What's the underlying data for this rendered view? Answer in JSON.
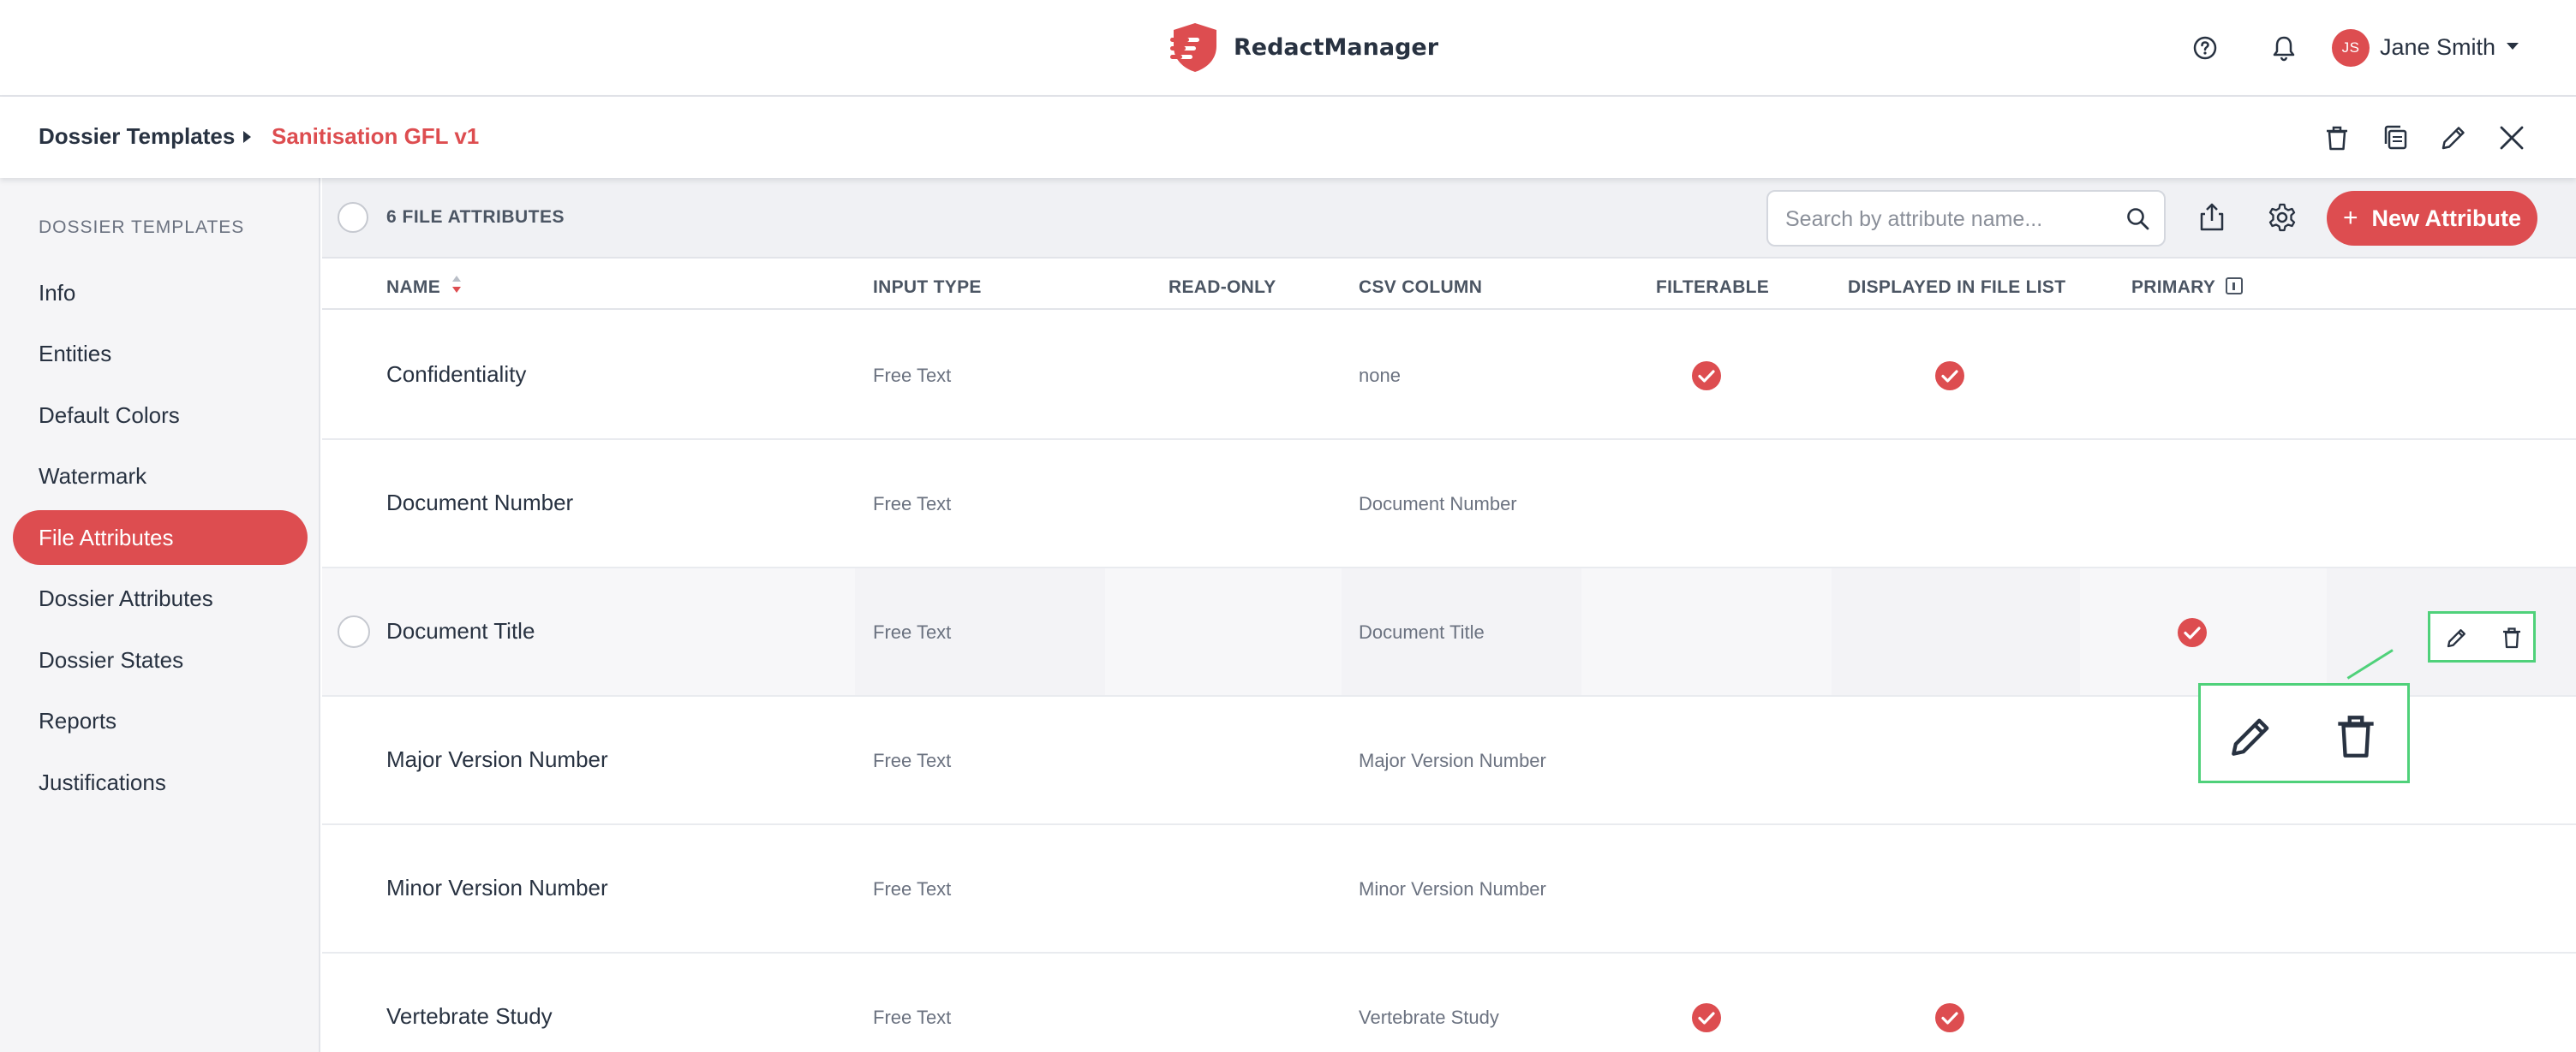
{
  "app": {
    "name": "RedactManager",
    "brand_color": "#dd4d50",
    "user": {
      "initials": "JS",
      "name": "Jane Smith"
    }
  },
  "breadcrumb": {
    "root": "Dossier Templates",
    "current": "Sanitisation GFL v1"
  },
  "sidebar": {
    "title": "DOSSIER TEMPLATES",
    "items": [
      {
        "label": "Info",
        "active": false
      },
      {
        "label": "Entities",
        "active": false
      },
      {
        "label": "Default Colors",
        "active": false
      },
      {
        "label": "Watermark",
        "active": false
      },
      {
        "label": "File Attributes",
        "active": true
      },
      {
        "label": "Dossier Attributes",
        "active": false
      },
      {
        "label": "Dossier States",
        "active": false
      },
      {
        "label": "Reports",
        "active": false
      },
      {
        "label": "Justifications",
        "active": false
      }
    ]
  },
  "toolbar": {
    "count_label": "6 FILE ATTRIBUTES",
    "search_placeholder": "Search by attribute name...",
    "new_button_label": "New Attribute",
    "new_button_icon": "plus-icon"
  },
  "table": {
    "columns": [
      "NAME",
      "INPUT TYPE",
      "READ-ONLY",
      "CSV COLUMN",
      "FILTERABLE",
      "DISPLAYED IN FILE LIST",
      "PRIMARY"
    ],
    "rows": [
      {
        "name": "Confidentiality",
        "input_type": "Free Text",
        "csv_column": "none",
        "filterable": true,
        "displayed": true,
        "primary": false
      },
      {
        "name": "Document Number",
        "input_type": "Free Text",
        "csv_column": "Document Number",
        "filterable": false,
        "displayed": false,
        "primary": false
      },
      {
        "name": "Document Title",
        "input_type": "Free Text",
        "csv_column": "Document Title",
        "filterable": false,
        "displayed": false,
        "primary": true
      },
      {
        "name": "Major Version Number",
        "input_type": "Free Text",
        "csv_column": "Major Version Number",
        "filterable": false,
        "displayed": false,
        "primary": false
      },
      {
        "name": "Minor Version Number",
        "input_type": "Free Text",
        "csv_column": "Minor Version Number",
        "filterable": false,
        "displayed": false,
        "primary": false
      },
      {
        "name": "Vertebrate Study",
        "input_type": "Free Text",
        "csv_column": "Vertebrate Study",
        "filterable": true,
        "displayed": true,
        "primary": false
      }
    ],
    "hovered_row": 2,
    "row_actions": [
      "pencil-icon",
      "trash-icon"
    ]
  },
  "highlight_color": "#4fd17a"
}
